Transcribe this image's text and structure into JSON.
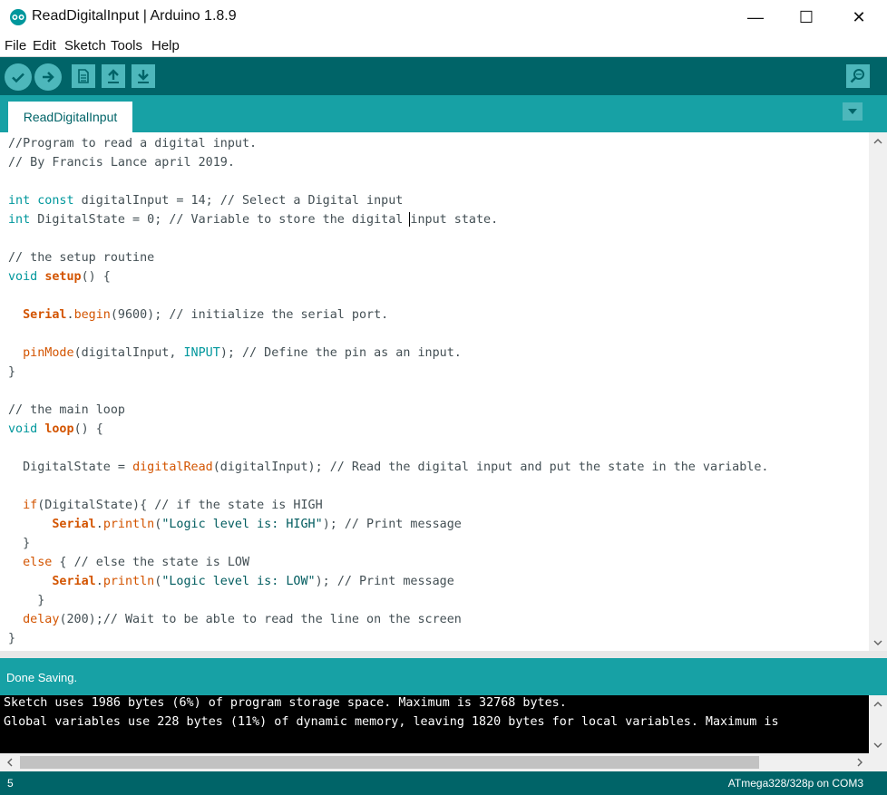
{
  "window": {
    "title": "ReadDigitalInput | Arduino 1.8.9",
    "minimize": "—",
    "maximize": "☐",
    "close": "✕"
  },
  "menu": [
    "File",
    "Edit",
    "Sketch",
    "Tools",
    "Help"
  ],
  "toolbar": {
    "buttons": [
      "verify-icon",
      "upload-icon",
      "new-icon",
      "open-icon",
      "save-icon"
    ],
    "serial_monitor": "serial-monitor-icon"
  },
  "tabs": [
    {
      "label": "ReadDigitalInput"
    }
  ],
  "code": [
    [
      [
        "//Program to read a digital input.",
        "cm"
      ]
    ],
    [
      [
        "// By Francis Lance april 2019.",
        "cm"
      ]
    ],
    [],
    [
      [
        "int",
        "kw"
      ],
      [
        " ",
        ""
      ],
      [
        "const",
        "kw"
      ],
      [
        " digitalInput = 14; ",
        ""
      ],
      [
        "// Select a Digital input",
        "cm"
      ]
    ],
    [
      [
        "int",
        "kw"
      ],
      [
        " DigitalState = 0; ",
        ""
      ],
      [
        "// Variable to store the digital ",
        "cm"
      ],
      [
        "|caret",
        "caret"
      ],
      [
        "input state.",
        "cm"
      ]
    ],
    [],
    [
      [
        "// the setup routine",
        "cm"
      ]
    ],
    [
      [
        "void",
        "kw"
      ],
      [
        " ",
        ""
      ],
      [
        "setup",
        "fnb"
      ],
      [
        "() {",
        ""
      ]
    ],
    [],
    [
      [
        "  ",
        ""
      ],
      [
        "Serial",
        "fnb"
      ],
      [
        ".",
        ""
      ],
      [
        "begin",
        "fn"
      ],
      [
        "(9600); ",
        ""
      ],
      [
        "// initialize the serial port.",
        "cm"
      ]
    ],
    [],
    [
      [
        "  ",
        ""
      ],
      [
        "pinMode",
        "fn"
      ],
      [
        "(digitalInput, ",
        ""
      ],
      [
        "INPUT",
        "kw"
      ],
      [
        "); ",
        ""
      ],
      [
        "// Define the pin as an input.",
        "cm"
      ]
    ],
    [
      [
        "}",
        ""
      ]
    ],
    [],
    [
      [
        "// the main loop",
        "cm"
      ]
    ],
    [
      [
        "void",
        "kw"
      ],
      [
        " ",
        ""
      ],
      [
        "loop",
        "fnb"
      ],
      [
        "() {",
        ""
      ]
    ],
    [],
    [
      [
        "  DigitalState = ",
        ""
      ],
      [
        "digitalRead",
        "fn"
      ],
      [
        "(digitalInput); ",
        ""
      ],
      [
        "// Read the digital input and put the state in the variable.",
        "cm"
      ]
    ],
    [],
    [
      [
        "  ",
        ""
      ],
      [
        "if",
        "fn"
      ],
      [
        "(DigitalState){ ",
        ""
      ],
      [
        "// if the state is HIGH",
        "cm"
      ]
    ],
    [
      [
        "      ",
        ""
      ],
      [
        "Serial",
        "fnb"
      ],
      [
        ".",
        ""
      ],
      [
        "println",
        "fn"
      ],
      [
        "(",
        ""
      ],
      [
        "\"Logic level is: HIGH\"",
        "str"
      ],
      [
        "); ",
        ""
      ],
      [
        "// Print message",
        "cm"
      ]
    ],
    [
      [
        "  }",
        ""
      ]
    ],
    [
      [
        "  ",
        ""
      ],
      [
        "else",
        "fn"
      ],
      [
        " { ",
        ""
      ],
      [
        "// else the state is LOW",
        "cm"
      ]
    ],
    [
      [
        "      ",
        ""
      ],
      [
        "Serial",
        "fnb"
      ],
      [
        ".",
        ""
      ],
      [
        "println",
        "fn"
      ],
      [
        "(",
        ""
      ],
      [
        "\"Logic level is: LOW\"",
        "str"
      ],
      [
        "); ",
        ""
      ],
      [
        "// Print message",
        "cm"
      ]
    ],
    [
      [
        "    }",
        ""
      ]
    ],
    [
      [
        "  ",
        ""
      ],
      [
        "delay",
        "fn"
      ],
      [
        "(200);",
        ""
      ],
      [
        "// Wait to be able to read the line on the screen",
        "cm"
      ]
    ],
    [
      [
        "}",
        ""
      ]
    ]
  ],
  "status": {
    "message": "Done Saving."
  },
  "console": [
    "Sketch uses 1986 bytes (6%) of program storage space. Maximum is 32768 bytes.",
    "Global variables use 228 bytes (11%) of dynamic memory, leaving 1820 bytes for local variables. Maximum is"
  ],
  "footer": {
    "line_number": "5",
    "board": "ATmega328/328p on COM3"
  },
  "colors": {
    "teal_dark": "#006468",
    "teal": "#17a1a5",
    "keyword": "#00979c",
    "function": "#d35400"
  }
}
